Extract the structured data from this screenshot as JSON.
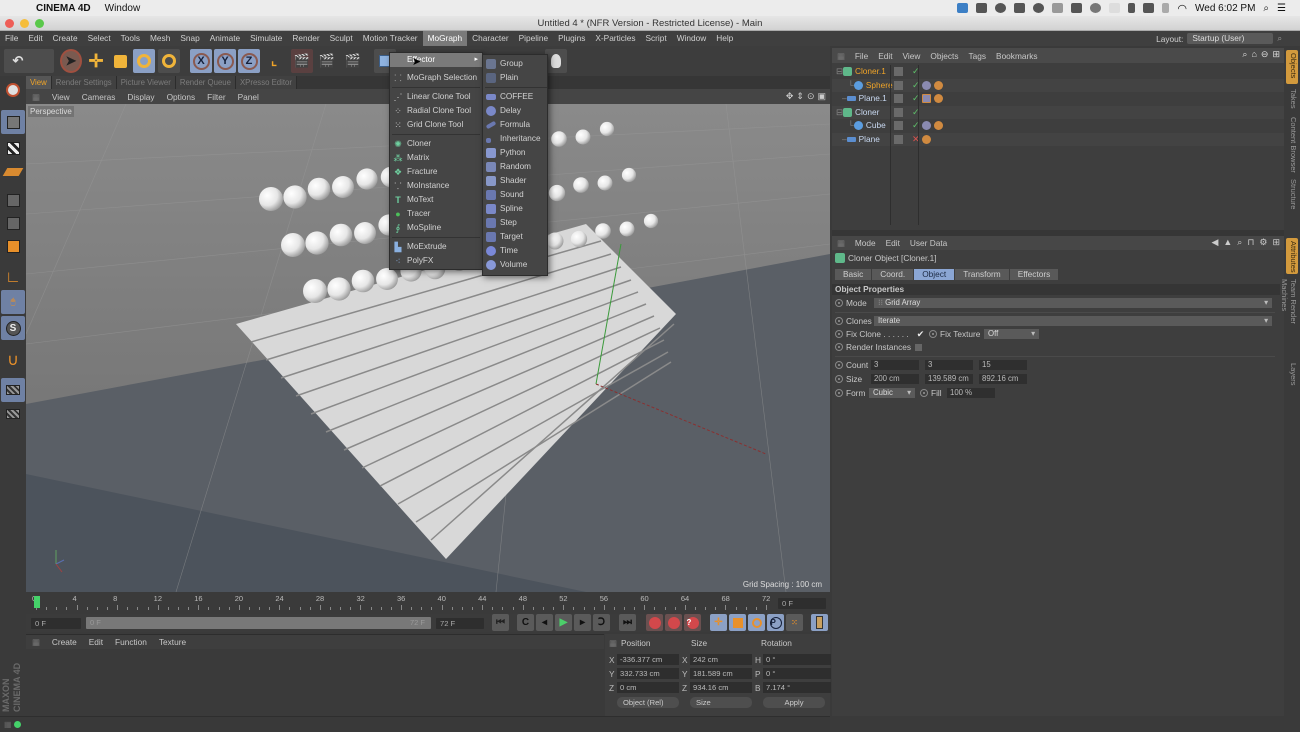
{
  "mac_menubar": {
    "app_name": "CINEMA 4D",
    "menus": [
      "Window"
    ],
    "clock": "Wed 6:02 PM",
    "status_icons": [
      "display-icon",
      "video-icon",
      "1password-icon",
      "dropbox-icon",
      "creative-cloud-icon",
      "dots-icon",
      "plus-icon",
      "sync-icon",
      "blank-icon",
      "flame-icon",
      "battery-icon",
      "bluetooth-icon",
      "wifi-icon"
    ]
  },
  "window": {
    "title": "Untitled 4 * (NFR Version - Restricted License) - Main"
  },
  "app_menu": {
    "items": [
      "File",
      "Edit",
      "Create",
      "Select",
      "Tools",
      "Mesh",
      "Snap",
      "Animate",
      "Simulate",
      "Render",
      "Sculpt",
      "Motion Tracker",
      "MoGraph",
      "Character",
      "Pipeline",
      "Plugins",
      "X-Particles",
      "Script",
      "Window",
      "Help"
    ],
    "active": "MoGraph",
    "layout_label": "Layout:",
    "layout_value": "Startup (User)"
  },
  "toolbar": {
    "axis_x": "X",
    "axis_y": "Y",
    "axis_z": "Z"
  },
  "viewport": {
    "tabs": [
      "View",
      "Render Settings",
      "Picture Viewer",
      "Render Queue",
      "XPresso Editor"
    ],
    "active_tab": "View",
    "menu": [
      "View",
      "Cameras",
      "Display",
      "Options",
      "Filter",
      "Panel"
    ],
    "label": "Perspective",
    "grid_spacing": "Grid Spacing : 100 cm"
  },
  "mograph_menu": {
    "items": [
      {
        "label": "Effector",
        "icon": "effector-icon",
        "submenu": true,
        "highlighted": true
      },
      {
        "label": "MoGraph Selection",
        "icon": "selection-icon"
      },
      {
        "label": "Linear Clone Tool",
        "icon": "linear-clone-icon"
      },
      {
        "label": "Radial Clone Tool",
        "icon": "radial-clone-icon"
      },
      {
        "label": "Grid Clone Tool",
        "icon": "grid-clone-icon"
      },
      {
        "label": "Cloner",
        "icon": "cloner-icon"
      },
      {
        "label": "Matrix",
        "icon": "matrix-icon"
      },
      {
        "label": "Fracture",
        "icon": "fracture-icon"
      },
      {
        "label": "MoInstance",
        "icon": "moinstance-icon"
      },
      {
        "label": "MoText",
        "icon": "motext-icon"
      },
      {
        "label": "Tracer",
        "icon": "tracer-icon"
      },
      {
        "label": "MoSpline",
        "icon": "mospline-icon"
      },
      {
        "label": "MoExtrude",
        "icon": "moextrude-icon"
      },
      {
        "label": "PolyFX",
        "icon": "polyfx-icon"
      }
    ]
  },
  "effector_submenu": {
    "items": [
      "Group",
      "Plain",
      "COFFEE",
      "Delay",
      "Formula",
      "Inheritance",
      "Python",
      "Random",
      "Shader",
      "Sound",
      "Spline",
      "Step",
      "Target",
      "Time",
      "Volume"
    ]
  },
  "timeline": {
    "ticks": [
      "0",
      "4",
      "8",
      "12",
      "16",
      "20",
      "24",
      "28",
      "32",
      "36",
      "40",
      "44",
      "48",
      "52",
      "56",
      "60",
      "64",
      "68",
      "72"
    ],
    "current_frame": "0 F",
    "start_field": "0 F",
    "range_start": "0 F",
    "range_end": "72 F",
    "end_field": "72 F"
  },
  "materials": {
    "menu": [
      "Create",
      "Edit",
      "Function",
      "Texture"
    ]
  },
  "coordinates": {
    "headers": [
      "Position",
      "Size",
      "Rotation"
    ],
    "position": {
      "x": "-336.377 cm",
      "y": "332.733 cm",
      "z": "0 cm"
    },
    "size": {
      "x": "242 cm",
      "y": "181.589 cm",
      "z": "934.16 cm"
    },
    "rotation": {
      "h": "0 °",
      "p": "0 °",
      "b": "7.174 °"
    },
    "labels": {
      "x": "X",
      "y": "Y",
      "z": "Z",
      "h": "H",
      "p": "P",
      "b": "B"
    },
    "mode_dropdown": "Object (Rel)",
    "size_dropdown": "Size",
    "apply_button": "Apply"
  },
  "object_manager": {
    "menu": [
      "File",
      "Edit",
      "View",
      "Objects",
      "Tags",
      "Bookmarks"
    ],
    "objects": [
      {
        "name": "Cloner.1",
        "type": "cloner",
        "indent": 0,
        "selected": true,
        "enabled": true
      },
      {
        "name": "Sphere",
        "type": "sphere",
        "indent": 1,
        "selected": true,
        "enabled": true
      },
      {
        "name": "Plane.1",
        "type": "plane",
        "indent": 0,
        "selected": false,
        "enabled": true
      },
      {
        "name": "Cloner",
        "type": "cloner",
        "indent": 0,
        "selected": false,
        "enabled": true
      },
      {
        "name": "Cube",
        "type": "cube",
        "indent": 1,
        "selected": false,
        "enabled": true
      },
      {
        "name": "Plane",
        "type": "plane",
        "indent": 0,
        "selected": false,
        "enabled": false
      }
    ],
    "side_tabs": [
      "Objects",
      "Takes",
      "Content Browser",
      "Structure"
    ]
  },
  "attributes": {
    "menu": [
      "Mode",
      "Edit",
      "User Data"
    ],
    "object_title": "Cloner Object [Cloner.1]",
    "tabs": [
      "Basic",
      "Coord.",
      "Object",
      "Transform",
      "Effectors"
    ],
    "active_tab": "Object",
    "section": "Object Properties",
    "mode_label": "Mode",
    "mode_value": "Grid Array",
    "clones_label": "Clones",
    "clones_value": "Iterate",
    "fix_clone_label": "Fix Clone . . . . . .",
    "fix_clone_checked": true,
    "fix_texture_label": "Fix Texture",
    "fix_texture_value": "Off",
    "render_instances_label": "Render Instances",
    "render_instances_checked": false,
    "count_label": "Count",
    "count": [
      "3",
      "3",
      "15"
    ],
    "size_label": "Size",
    "size": [
      "200 cm",
      "139.589 cm",
      "892.16 cm"
    ],
    "form_label": "Form",
    "form_value": "Cubic",
    "fill_label": "Fill",
    "fill_value": "100 %",
    "side_tabs": [
      "Attributes",
      "Team Render Machines",
      "Layers"
    ]
  },
  "branding": {
    "logo_text": "MAXON CINEMA 4D"
  },
  "colors": {
    "accent_orange": "#f0a428",
    "selection_blue": "#8ba6d4",
    "play_green": "#4ccf6a",
    "record_red": "#d3484b"
  }
}
